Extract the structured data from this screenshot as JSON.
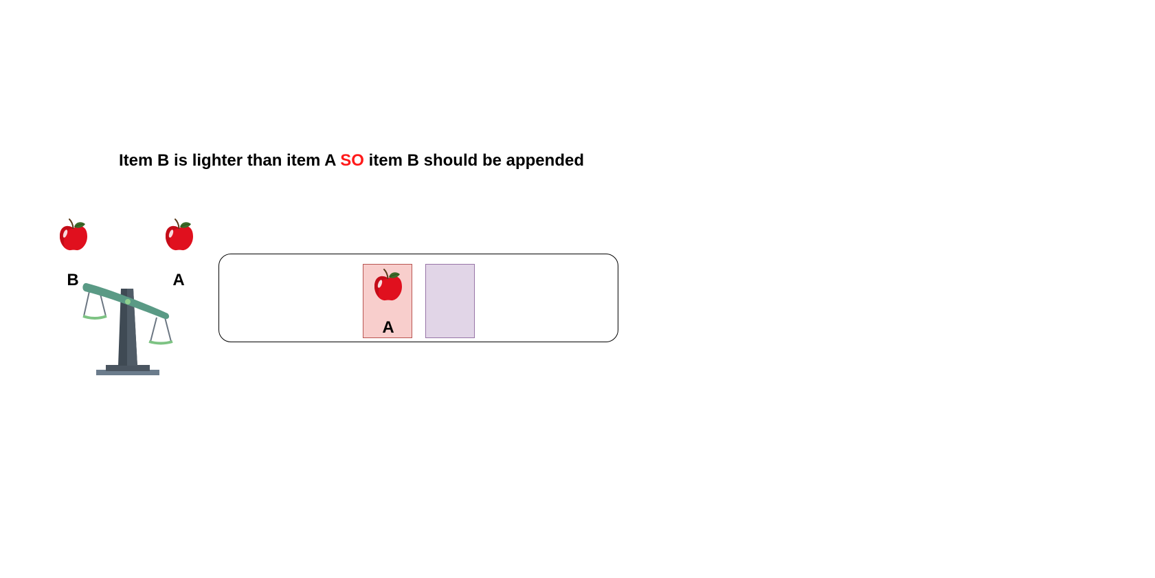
{
  "headline": {
    "part1": "Item B is lighter than item A ",
    "highlight": "SO",
    "part2": " item B should be appended",
    "highlight_color": "#ff1a1a"
  },
  "scale": {
    "left_item": {
      "label": "B",
      "icon": "apple-icon"
    },
    "right_item": {
      "label": "A",
      "icon": "apple-icon"
    },
    "tilt": "left side up (lighter)"
  },
  "list": {
    "items": [
      {
        "label": "A",
        "icon": "apple-icon",
        "fill": "#f8cecc"
      },
      {
        "label": "",
        "icon": "",
        "fill": "#e1d5e7"
      }
    ]
  }
}
